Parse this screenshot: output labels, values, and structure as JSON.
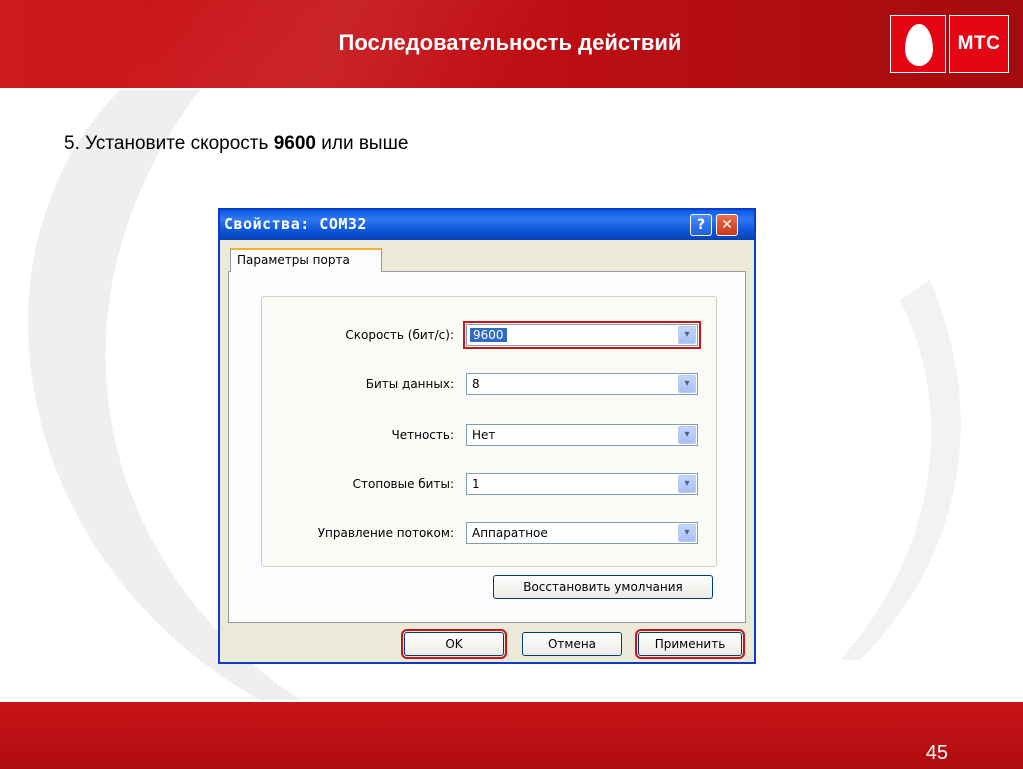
{
  "slide": {
    "title": "Последовательность действий",
    "page_number": "45",
    "brand": {
      "logo_text": "МТС",
      "accent_color": "#c8151b"
    }
  },
  "step": {
    "prefix": "5. Установите скорость ",
    "speed_value": "9600",
    "suffix": " или выше"
  },
  "dialog": {
    "title": "Свойства: COM32",
    "help_button": "?",
    "close_button": "✕",
    "tab_label": "Параметры порта",
    "fields": [
      {
        "label": "Скорость (бит/с):",
        "value": "9600",
        "arrow": "▾"
      },
      {
        "label": "Биты данных:",
        "value": "8",
        "arrow": "▾"
      },
      {
        "label": "Четность:",
        "value": "Нет",
        "arrow": "▾"
      },
      {
        "label": "Стоповые биты:",
        "value": "1",
        "arrow": "▾"
      },
      {
        "label": "Управление потоком:",
        "value": "Аппаратное",
        "arrow": "▾"
      }
    ],
    "restore_defaults_label": "Восстановить умолчания",
    "ok_label": "OK",
    "cancel_label": "Отмена",
    "apply_label": "Применить"
  }
}
